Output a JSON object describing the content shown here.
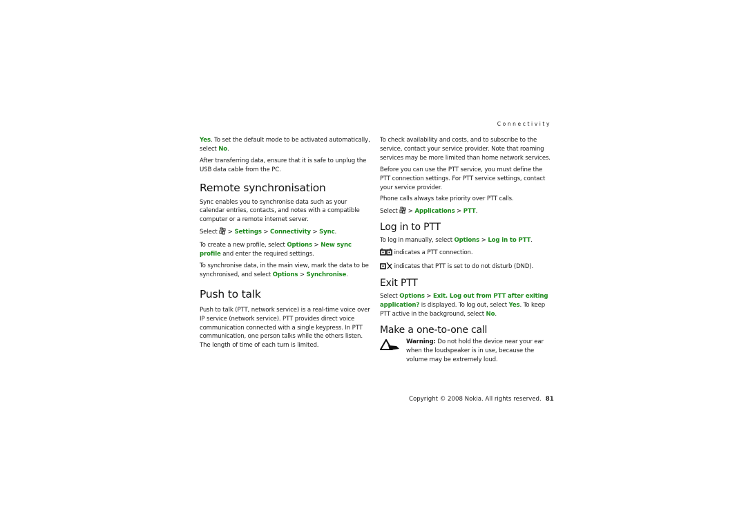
{
  "running_head": "Connectivity",
  "left_column": {
    "p1": {
      "yes": "Yes",
      "t1": ". To set the default mode to be activated automatically, select ",
      "no": "No",
      "t2": "."
    },
    "p2": "After transferring data, ensure that it is safe to unplug the USB data cable from the PC.",
    "remote_sync": {
      "heading": "Remote synchronisation",
      "intro": "Sync enables you to synchronise data such as your calendar entries, contacts, and notes with a compatible computer or a remote internet server.",
      "path": {
        "select": "Select",
        "sep": " > ",
        "s1": "Settings",
        "s2": "Connectivity",
        "s3": "Sync",
        "end": "."
      },
      "new_profile": {
        "t1": "To create a new profile, select ",
        "options": "Options",
        "sep": " > ",
        "item": "New sync profile",
        "t2": " and enter the required settings."
      },
      "sync_data": {
        "t1": "To synchronise data, in the main view, mark the data to be synchronised, and select ",
        "options": "Options",
        "sep": " > ",
        "item": "Synchronise",
        "t2": "."
      }
    },
    "push_to_talk": {
      "heading": "Push to talk",
      "body": "Push to talk (PTT, network service) is a real-time voice over IP service (network service). PTT provides direct voice communication connected with a single keypress. In PTT communication, one person talks while the others listen. The length of time of each turn is limited."
    }
  },
  "right_column": {
    "p1": "To check availability and costs, and to subscribe to the service, contact your service provider. Note that roaming services may be more limited than home network services.",
    "p2": "Before you can use the PTT service, you must define the PTT connection settings. For PTT service settings, contact your service provider.",
    "p3": "Phone calls always take priority over PTT calls.",
    "path": {
      "select": "Select",
      "sep": " > ",
      "s1": "Applications",
      "s2": "PTT",
      "end": "."
    },
    "log_in": {
      "heading": "Log in to PTT",
      "manual": {
        "t1": "To log in manually, select ",
        "options": "Options",
        "sep": " > ",
        "item": "Log in to PTT",
        "t2": "."
      },
      "icon1_text": " indicates a PTT connection.",
      "icon2_text": " indicates that PTT is set to do not disturb (DND)."
    },
    "exit": {
      "heading": "Exit PTT",
      "t1": "Select ",
      "options": "Options",
      "sep": " > ",
      "item": "Exit",
      "t2": ". ",
      "prompt": "Log out from PTT after exiting application?",
      "t3": " is displayed. To log out, select ",
      "yes": "Yes",
      "t4": ". To keep PTT active in the background, select ",
      "no": "No",
      "t5": "."
    },
    "one_to_one": {
      "heading": "Make a one-to-one call",
      "warning_label": "Warning:",
      "warning_text": " Do not hold the device near your ear when the loudspeaker is in use, because the volume may be extremely loud."
    }
  },
  "footer": {
    "copyright": "Copyright © 2008 Nokia. All rights reserved.",
    "page_number": "81"
  },
  "colors": {
    "highlight": "#1f8a1f",
    "text": "#1a1a1a"
  }
}
